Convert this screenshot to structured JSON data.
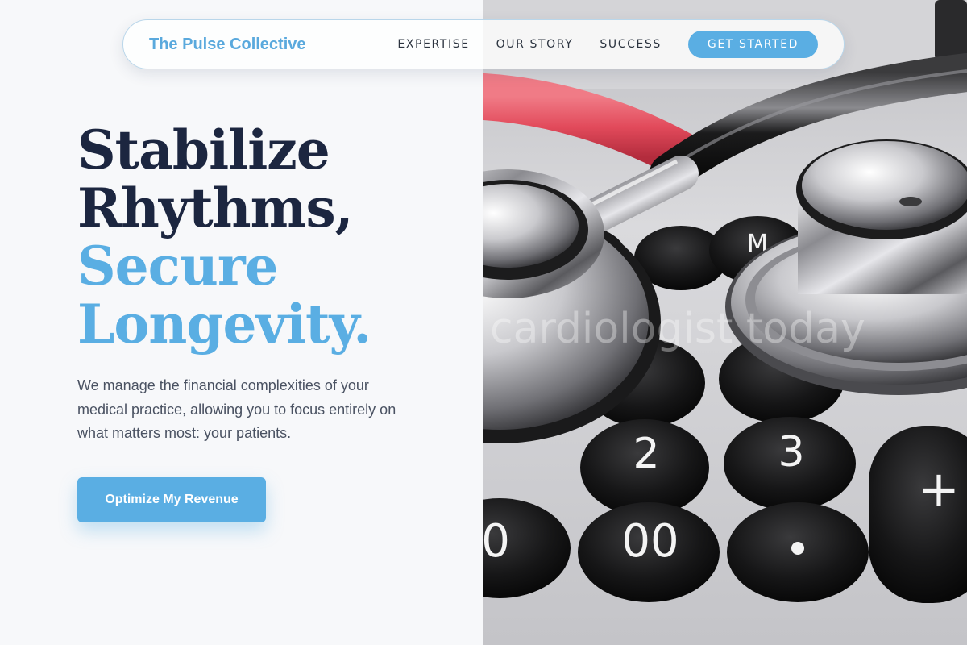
{
  "nav": {
    "brand": "The Pulse Collective",
    "links": [
      "EXPERTISE",
      "OUR STORY",
      "SUCCESS"
    ],
    "cta": "GET STARTED"
  },
  "hero": {
    "title_line1": "Stabilize",
    "title_line2": "Rhythms,",
    "title_line3": "Secure",
    "title_line4": "Longevity.",
    "description": "We manage the financial complexities of your medical practice, allowing you to focus entirely on what matters most: your patients.",
    "cta": "Optimize My Revenue"
  },
  "image": {
    "subject": "stethoscope-on-calculator-photo",
    "watermark": "cardiologist-today"
  },
  "calculator_keys": [
    "2",
    "3",
    "+",
    "0",
    "00",
    "•",
    "M"
  ],
  "colors": {
    "accent": "#5aaee3",
    "heading_dark": "#1c2640",
    "body_text": "#4a5262",
    "background": "#f7f8fa"
  }
}
